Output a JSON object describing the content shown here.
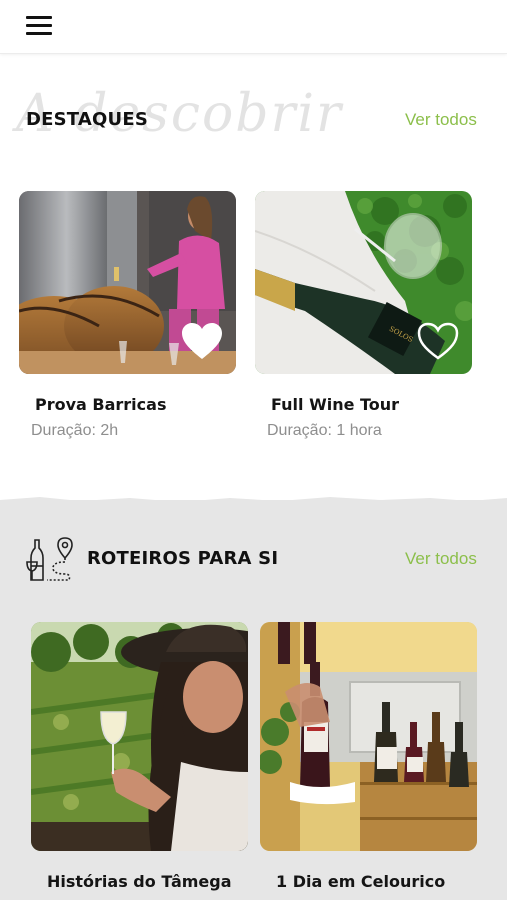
{
  "header": {
    "menu_icon": "hamburger-menu-icon"
  },
  "highlights": {
    "script_watermark": "A descobrir",
    "title": "DESTAQUES",
    "see_all": "Ver todos",
    "cards": [
      {
        "title": "Prova Barricas",
        "duration": "Duração: 2h",
        "icon": "heart-icon"
      },
      {
        "title": "Full Wine Tour",
        "duration": "Duração: 1 hora",
        "icon": "heart-icon"
      }
    ]
  },
  "routes": {
    "icon": "wine-route-icon",
    "title": "ROTEIROS PARA SI",
    "see_all": "Ver todos",
    "cards": [
      {
        "title": "Histórias do Tâmega"
      },
      {
        "title": "1 Dia em Celourico"
      }
    ]
  },
  "colors": {
    "accent": "#8cbf4b",
    "grey_bg": "#e6e6e6"
  }
}
